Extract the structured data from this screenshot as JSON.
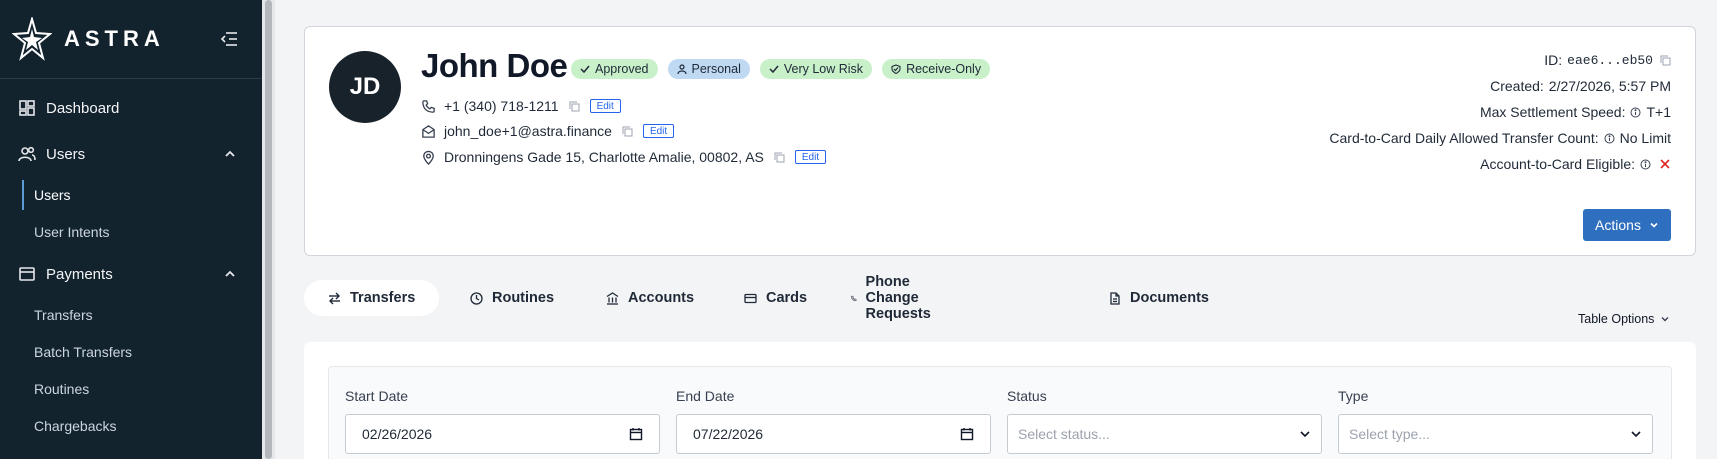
{
  "brand": {
    "name": "ASTRA"
  },
  "sidebar": {
    "items": [
      {
        "label": "Dashboard"
      },
      {
        "label": "Users"
      },
      {
        "label": "Users"
      },
      {
        "label": "User Intents"
      },
      {
        "label": "Payments"
      },
      {
        "label": "Transfers"
      },
      {
        "label": "Batch Transfers"
      },
      {
        "label": "Routines"
      },
      {
        "label": "Chargebacks"
      }
    ]
  },
  "profile": {
    "initials": "JD",
    "name": "John Doe",
    "badges": [
      "Approved",
      "Personal",
      "Very Low Risk",
      "Receive-Only"
    ],
    "phone": "+1 (340) 718-1211",
    "email": "john_doe+1@astra.finance",
    "address": "Dronningens Gade 15, Charlotte Amalie, 00802, AS",
    "edit_label": "Edit",
    "meta": {
      "id_label": "ID:",
      "id_value": "eae6...eb50",
      "created_label": "Created:",
      "created_value": "2/27/2026, 5:57 PM",
      "settlement_label": "Max Settlement Speed:",
      "settlement_value": "T+1",
      "c2c_label": "Card-to-Card Daily Allowed Transfer Count:",
      "c2c_value": "No Limit",
      "a2c_label": "Account-to-Card Eligible:"
    },
    "actions_label": "Actions"
  },
  "tabs": [
    {
      "label": "Transfers"
    },
    {
      "label": "Routines"
    },
    {
      "label": "Accounts"
    },
    {
      "label": "Cards"
    },
    {
      "label": "Phone Change Requests"
    },
    {
      "label": "Documents"
    }
  ],
  "table_options_label": "Table Options",
  "filters": {
    "start_date_label": "Start Date",
    "start_date_value": "02/26/2026",
    "end_date_label": "End Date",
    "end_date_value": "07/22/2026",
    "status_label": "Status",
    "status_placeholder": "Select status...",
    "type_label": "Type",
    "type_placeholder": "Select type..."
  },
  "colors": {
    "sidebar_bg": "#13232e",
    "primary": "#2f6fbf",
    "badge_green": "#c8f0c9",
    "badge_blue": "#bfd9f2",
    "danger": "#dc2626"
  }
}
